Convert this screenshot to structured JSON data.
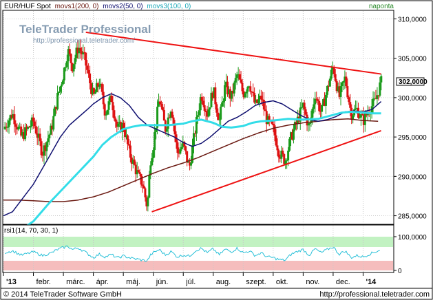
{
  "header": {
    "instrument": "EUR/HUF Spot",
    "indicator1": "movs1(200, 0)",
    "indicator2": "movs2(50, 0)",
    "indicator3": "movs3(100, 0)",
    "period": "naponta"
  },
  "watermark": {
    "brand": "TeleTrader Professional",
    "url": "http://professional.teletrader.com/"
  },
  "rsi_label": "rsi1(14, 70, 30, 1)",
  "footer": {
    "copyright": "© 2014 TeleTrader Software GmbH",
    "url": "http://professional.teletrader.com"
  },
  "colors": {
    "background": "#ffffff",
    "grid": "#c8c8c8",
    "up_candle": "#1a9a1a",
    "down_candle": "#dd1111",
    "movs1_200": "#6b1a12",
    "movs2_50": "#101070",
    "movs3_100": "#33dde8",
    "trendline": "#ee1111",
    "rsi_line": "#28c0d8",
    "rsi_overbought_zone": "#c2f2c2",
    "rsi_oversold_zone": "#f5bdbd",
    "frame": "#000000"
  },
  "chart_data": [
    {
      "type": "candlestick",
      "title": "EUR/HUF Spot",
      "ylim": [
        284,
        311
      ],
      "y_ticks": [
        "310,0000",
        "305,0000",
        "300,0000",
        "295,0000",
        "290,0000",
        "285,0000"
      ],
      "y_tick_values": [
        310,
        305,
        300,
        295,
        290,
        285
      ],
      "x_ticks": [
        "'13",
        "febr.",
        "márc.",
        "ápr.",
        "máj.",
        "jún.",
        "júl.",
        "aug.",
        "szept.",
        "okt.",
        "nov.",
        "dec.",
        "'14"
      ],
      "x_tick_values": [
        0,
        1,
        2,
        3,
        4,
        5,
        6,
        7,
        8,
        9,
        10,
        11,
        12
      ],
      "x_max": 13.0,
      "grid": true,
      "last_price_label": "302,0000",
      "last_price": 302.0,
      "price_path_months": [
        0,
        0.3,
        0.6,
        1.0,
        1.3,
        1.6,
        1.8,
        2.0,
        2.15,
        2.3,
        2.5,
        2.7,
        3.0,
        3.2,
        3.4,
        3.6,
        3.8,
        4.0,
        4.2,
        4.4,
        4.5,
        4.65,
        4.8,
        4.9,
        5.0,
        5.2,
        5.4,
        5.6,
        5.8,
        6.0,
        6.2,
        6.4,
        6.6,
        6.8,
        7.0,
        7.2,
        7.4,
        7.6,
        7.8,
        8.0,
        8.2,
        8.4,
        8.6,
        8.8,
        9.0,
        9.2,
        9.4,
        9.6,
        9.8,
        10.0,
        10.2,
        10.4,
        10.6,
        10.8,
        11.0,
        11.2,
        11.4,
        11.6,
        11.8,
        12.0,
        12.2,
        12.4,
        12.6
      ],
      "price_path_values": [
        296.0,
        298.0,
        295.0,
        297.0,
        293.0,
        296.0,
        300.0,
        303.0,
        306.0,
        304.0,
        306.5,
        305.0,
        300.0,
        302.0,
        298.0,
        300.0,
        296.0,
        296.5,
        293.0,
        291.0,
        290.0,
        289.0,
        286.0,
        292.0,
        294.0,
        300.0,
        296.0,
        299.0,
        293.0,
        294.0,
        291.0,
        296.0,
        300.5,
        298.0,
        301.0,
        297.0,
        301.5,
        300.0,
        303.0,
        300.5,
        302.0,
        299.0,
        300.0,
        297.0,
        296.0,
        293.0,
        292.0,
        295.0,
        297.0,
        299.0,
        296.0,
        300.5,
        298.0,
        301.0,
        304.0,
        300.0,
        302.5,
        298.0,
        298.5,
        297.0,
        298.5,
        299.5,
        302.0
      ],
      "series": [
        {
          "name": "movs1(200, 0)",
          "x": [
            0,
            0.5,
            1.0,
            1.5,
            2.0,
            2.5,
            3.0,
            3.5,
            4.0,
            4.5,
            5.0,
            5.5,
            6.0,
            6.5,
            7.0,
            7.5,
            8.0,
            8.5,
            9.0,
            9.5,
            10.0,
            10.5,
            11.0,
            11.5,
            12.0,
            12.5
          ],
          "values": [
            287.0,
            287.0,
            286.9,
            286.8,
            286.8,
            287.0,
            287.4,
            288.0,
            288.8,
            289.6,
            290.4,
            291.1,
            291.7,
            292.4,
            293.2,
            294.0,
            294.8,
            295.5,
            296.1,
            296.5,
            296.8,
            297.0,
            297.2,
            297.3,
            297.1,
            297.0
          ]
        },
        {
          "name": "movs2(50, 0)",
          "x": [
            0,
            0.3,
            0.6,
            1.0,
            1.3,
            1.6,
            1.9,
            2.2,
            2.5,
            2.8,
            3.0,
            3.3,
            3.6,
            3.9,
            4.2,
            4.5,
            4.8,
            5.1,
            5.4,
            5.7,
            6.0,
            6.3,
            6.6,
            6.9,
            7.2,
            7.5,
            7.8,
            8.1,
            8.4,
            8.7,
            9.0,
            9.3,
            9.6,
            9.9,
            10.2,
            10.5,
            10.8,
            11.1,
            11.4,
            11.7,
            12.0,
            12.3,
            12.6
          ],
          "values": [
            285.0,
            285.5,
            287.0,
            289.0,
            291.0,
            293.0,
            295.0,
            296.5,
            297.5,
            298.5,
            299.2,
            300.0,
            300.5,
            300.0,
            299.0,
            297.5,
            296.5,
            296.0,
            295.5,
            295.0,
            294.3,
            293.8,
            294.2,
            295.0,
            296.0,
            297.0,
            297.5,
            298.2,
            299.0,
            299.4,
            299.6,
            299.2,
            298.5,
            297.8,
            297.2,
            297.0,
            297.2,
            297.6,
            298.2,
            298.3,
            298.2,
            298.5,
            299.5
          ]
        },
        {
          "name": "movs3(100, 0)",
          "x": [
            0,
            0.5,
            1.0,
            1.5,
            2.0,
            2.5,
            3.0,
            3.3,
            3.6,
            4.0,
            4.3,
            4.6,
            5.0,
            5.5,
            6.0,
            6.3,
            6.6,
            7.0,
            7.3,
            7.6,
            8.0,
            8.3,
            8.6,
            9.0,
            9.5,
            10.0,
            10.5,
            11.0,
            11.3,
            11.6,
            12.0,
            12.3,
            12.6
          ],
          "values": [
            282.0,
            283.0,
            284.3,
            286.5,
            288.5,
            290.5,
            292.5,
            294.0,
            295.0,
            296.0,
            296.3,
            296.5,
            296.5,
            296.5,
            296.7,
            297.0,
            297.2,
            296.8,
            296.3,
            296.2,
            296.4,
            296.8,
            297.0,
            297.1,
            297.3,
            297.2,
            297.3,
            297.8,
            298.1,
            298.2,
            298.1,
            298.0,
            298.0
          ]
        }
      ],
      "trendlines": [
        {
          "x": [
            2.75,
            12.6
          ],
          "values": [
            308.3,
            303.0
          ]
        },
        {
          "x": [
            4.95,
            12.6
          ],
          "values": [
            285.5,
            295.8
          ]
        }
      ]
    },
    {
      "type": "line",
      "title": "rsi1(14, 70, 30, 1)",
      "ylim": [
        0,
        100
      ],
      "y_ticks": [
        "100,0000",
        "0"
      ],
      "y_tick_values": [
        100,
        0
      ],
      "bands": {
        "overbought": [
          70,
          100
        ],
        "oversold": [
          0,
          30
        ]
      },
      "series": [
        {
          "name": "rsi1(14, 70, 30, 1)",
          "x": [
            0,
            0.3,
            0.6,
            1.0,
            1.3,
            1.6,
            1.8,
            2.0,
            2.15,
            2.3,
            2.5,
            2.7,
            3.0,
            3.2,
            3.4,
            3.6,
            3.8,
            4.0,
            4.2,
            4.4,
            4.5,
            4.65,
            4.8,
            4.9,
            5.0,
            5.2,
            5.4,
            5.6,
            5.8,
            6.0,
            6.2,
            6.4,
            6.6,
            6.8,
            7.0,
            7.2,
            7.4,
            7.6,
            7.8,
            8.0,
            8.2,
            8.4,
            8.6,
            8.8,
            9.0,
            9.2,
            9.4,
            9.6,
            9.8,
            10.0,
            10.2,
            10.4,
            10.6,
            10.8,
            11.0,
            11.2,
            11.4,
            11.6,
            11.8,
            12.0,
            12.2,
            12.4,
            12.6
          ],
          "values": [
            52,
            58,
            45,
            55,
            44,
            52,
            62,
            68,
            72,
            62,
            67,
            56,
            38,
            48,
            40,
            47,
            37,
            43,
            38,
            34,
            33,
            30,
            28,
            45,
            52,
            62,
            46,
            56,
            40,
            46,
            42,
            58,
            66,
            52,
            64,
            46,
            63,
            55,
            66,
            52,
            58,
            44,
            52,
            40,
            38,
            32,
            30,
            48,
            56,
            62,
            45,
            64,
            52,
            62,
            70,
            48,
            58,
            38,
            44,
            40,
            48,
            55,
            62
          ]
        }
      ]
    }
  ]
}
